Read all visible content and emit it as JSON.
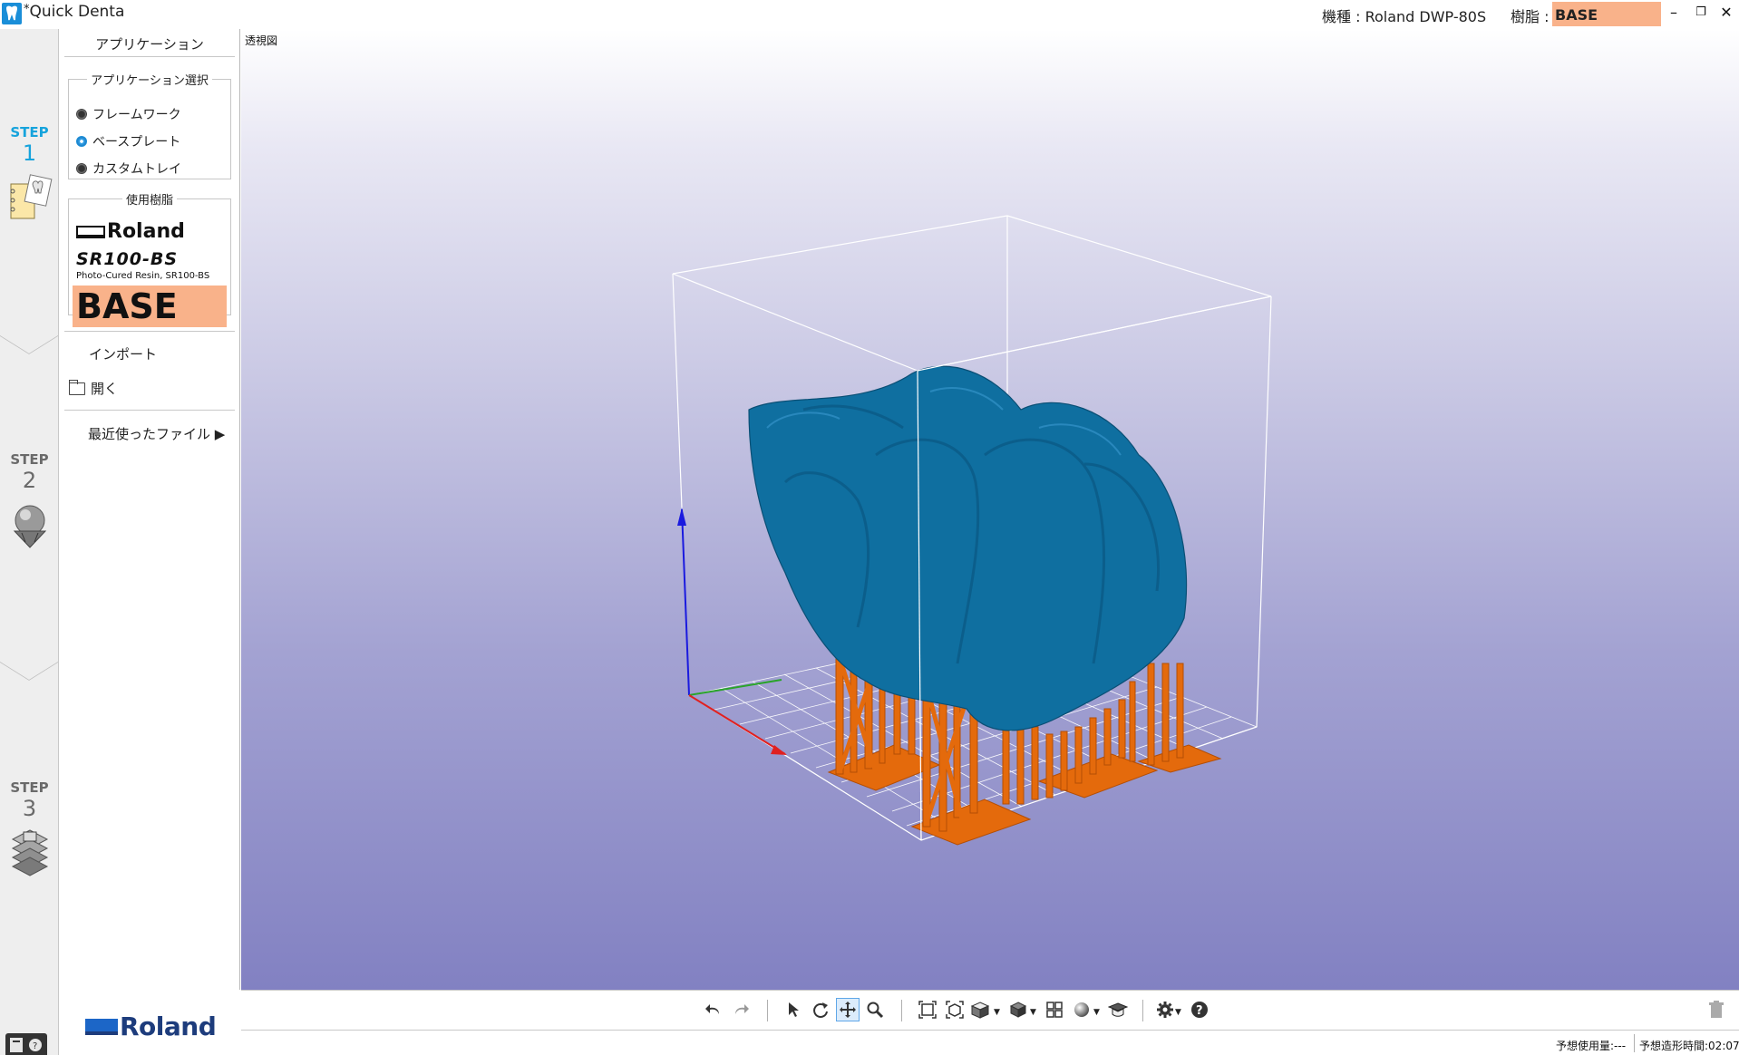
{
  "window": {
    "title_mark": "*",
    "title": "Quick Denta",
    "machine_label": "機種 : Roland DWP-80S",
    "resin_label": "樹脂 :",
    "resin_value": "BASE",
    "minimize": "–",
    "restore": "❐",
    "close": "✕"
  },
  "steps": [
    {
      "label": "STEP",
      "number": "1",
      "state": "active"
    },
    {
      "label": "STEP",
      "number": "2",
      "state": "inactive"
    },
    {
      "label": "STEP",
      "number": "3",
      "state": "inactive"
    }
  ],
  "panel": {
    "title": "アプリケーション",
    "app_select_legend": "アプリケーション選択",
    "applications": [
      {
        "label": "フレームワーク",
        "selected": false
      },
      {
        "label": "ベースプレート",
        "selected": true
      },
      {
        "label": "カスタムトレイ",
        "selected": false
      }
    ],
    "resin_legend": "使用樹脂",
    "resin_brand": "Roland",
    "resin_model": "SR100-BS",
    "resin_desc": "Photo-Cured Resin, SR100-BS",
    "resin_name": "BASE",
    "import_label": "インポート",
    "open_label": "開く",
    "recent_label": "最近使ったファイル ▶",
    "logo_text": "Roland"
  },
  "viewport": {
    "view_label": "透視図"
  },
  "toolbar": {
    "icons": [
      "undo-icon",
      "redo-icon",
      "select-icon",
      "rotate-icon",
      "pan-icon",
      "zoom-icon",
      "fit-view-icon",
      "fit-selection-icon",
      "view-cube-icon",
      "display-mode-icon",
      "layout-icon",
      "material-icon",
      "cap-icon",
      "settings-icon",
      "help-icon",
      "trash-icon"
    ]
  },
  "status": {
    "usage": "予想使用量:---",
    "time": "予想造形時間:02:07"
  },
  "colors": {
    "accent": "#16a3dc",
    "resin_highlight": "#f9b28a",
    "model_blue": "#0f6fa0",
    "support_orange": "#e46a0c"
  }
}
